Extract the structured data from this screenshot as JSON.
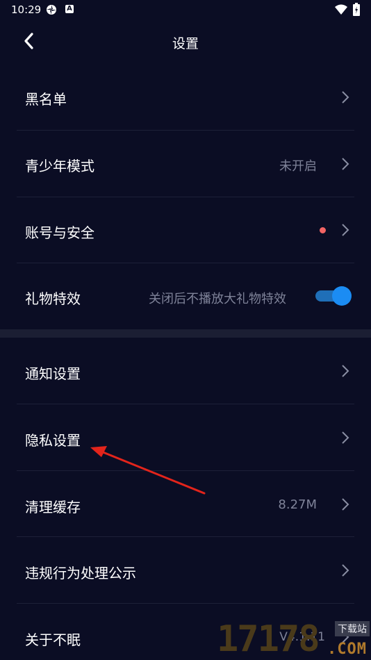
{
  "status_bar": {
    "time": "10:29",
    "notification_badge": "A",
    "icons": [
      "target-icon",
      "a-badge-icon",
      "wifi-icon",
      "battery-icon"
    ]
  },
  "header": {
    "title": "设置",
    "back_icon": "chevron-left-icon"
  },
  "settings": {
    "items": [
      {
        "label": "黑名单",
        "value": ""
      },
      {
        "label": "青少年模式",
        "value": "未开启"
      },
      {
        "label": "账号与安全",
        "value": ""
      },
      {
        "label": "礼物特效",
        "value": "关闭后不播放大礼物特效",
        "toggle_on": true
      },
      {
        "label": "通知设置",
        "value": ""
      },
      {
        "label": "隐私设置",
        "value": ""
      },
      {
        "label": "清理缓存",
        "value": "8.27M"
      },
      {
        "label": "违规行为处理公示",
        "value": ""
      },
      {
        "label": "关于不眠",
        "value": "V4.1.11"
      }
    ]
  },
  "watermark": {
    "number": "17178",
    "badge": "下载站",
    "domain": ".COM"
  },
  "colors": {
    "background": "#0b0d24",
    "accent": "#1b8cf3",
    "alert_dot": "#f36464",
    "annotation_arrow": "#e3241b"
  }
}
